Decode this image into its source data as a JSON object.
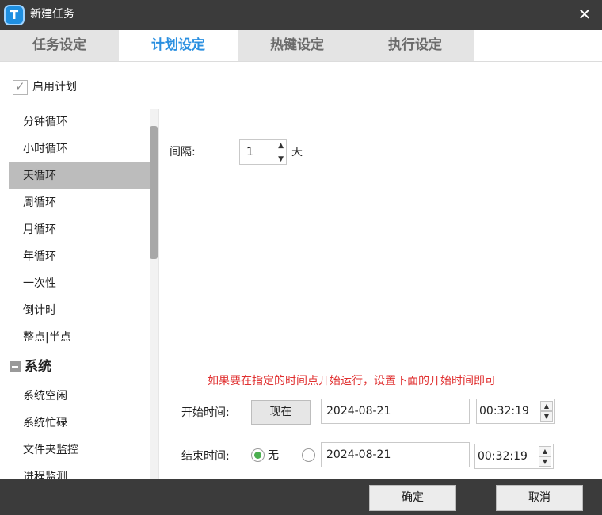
{
  "window": {
    "title": "新建任务",
    "app_icon_letter": "T",
    "close_symbol": "✕"
  },
  "tabs": [
    {
      "label": "任务设定",
      "active": false
    },
    {
      "label": "计划设定",
      "active": true
    },
    {
      "label": "热键设定",
      "active": false
    },
    {
      "label": "执行设定",
      "active": false
    }
  ],
  "enable_plan": {
    "label": "启用计划",
    "checked": true,
    "check_symbol": "✓"
  },
  "schedule_list": {
    "items": [
      {
        "label": "分钟循环"
      },
      {
        "label": "小时循环"
      },
      {
        "label": "天循环",
        "selected": true
      },
      {
        "label": "周循环"
      },
      {
        "label": "月循环"
      },
      {
        "label": "年循环"
      },
      {
        "label": "一次性"
      },
      {
        "label": "倒计时"
      },
      {
        "label": "整点|半点"
      }
    ],
    "group": {
      "label": "系统"
    },
    "group_items": [
      {
        "label": "系统空闲"
      },
      {
        "label": "系统忙碌"
      },
      {
        "label": "文件夹监控"
      },
      {
        "label": "进程监测"
      }
    ]
  },
  "interval": {
    "label": "间隔:",
    "value": "1",
    "unit": "天",
    "up_symbol": "▲",
    "down_symbol": "▼"
  },
  "hint": "如果要在指定的时间点开始运行，设置下面的开始时间即可",
  "start": {
    "label": "开始时间:",
    "now_button": "现在",
    "date": "2024-08-21",
    "time": "00:32:19"
  },
  "end": {
    "label": "结束时间:",
    "none_label": "无",
    "none_selected": true,
    "date": "2024-08-21",
    "time": "00:32:19"
  },
  "footer": {
    "ok": "确定",
    "cancel": "取消"
  },
  "colors": {
    "titlebar": "#3b3b3b",
    "active_tab_text": "#2a8fe0",
    "hint_text": "#e03030",
    "radio_on": "#4caf50",
    "selected_item_bg": "#bcbcbc"
  }
}
